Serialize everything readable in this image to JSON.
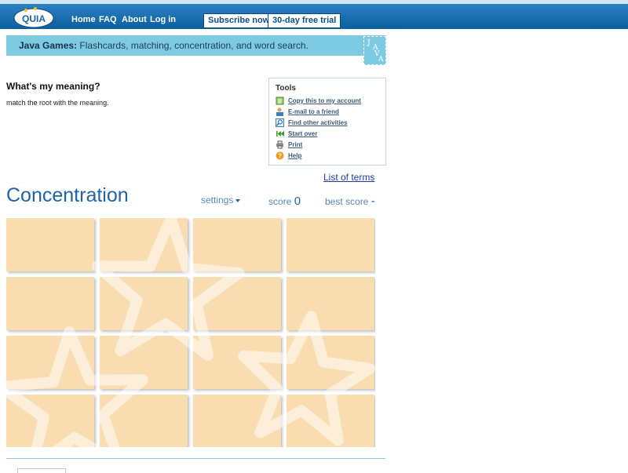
{
  "header": {
    "logo_text": "QUIA",
    "nav": [
      "Home",
      "FAQ",
      "About",
      "Log in"
    ],
    "subscribe_label": "Subscribe now",
    "trial_label": "30-day free trial"
  },
  "banner": {
    "bold": "Java Games:",
    "text": " Flashcards, matching, concentration, and word search.",
    "java_letters": [
      "J",
      "A",
      "V",
      "A"
    ]
  },
  "activity": {
    "title": "What's my meaning?",
    "description": "match the root with the meaning."
  },
  "tools": {
    "title": "Tools",
    "items": [
      {
        "label": "Copy this to my account",
        "icon": "copy-icon"
      },
      {
        "label": "E-mail to a friend",
        "icon": "email-icon"
      },
      {
        "label": "Find other activities",
        "icon": "find-icon"
      },
      {
        "label": "Start over",
        "icon": "rewind-icon"
      },
      {
        "label": "Print",
        "icon": "print-icon"
      },
      {
        "label": "Help",
        "icon": "help-icon"
      }
    ]
  },
  "list_of_terms": "List of terms",
  "game": {
    "title": "Concentration",
    "settings_label": "settings",
    "score_label": "score",
    "score_value": "0",
    "best_score_label": "best score",
    "best_score_value": "-",
    "rows": 4,
    "cols": 4
  },
  "colors": {
    "card": "#f9ddb1",
    "accent": "#1f63a8",
    "banner": "#7dcbe2"
  }
}
